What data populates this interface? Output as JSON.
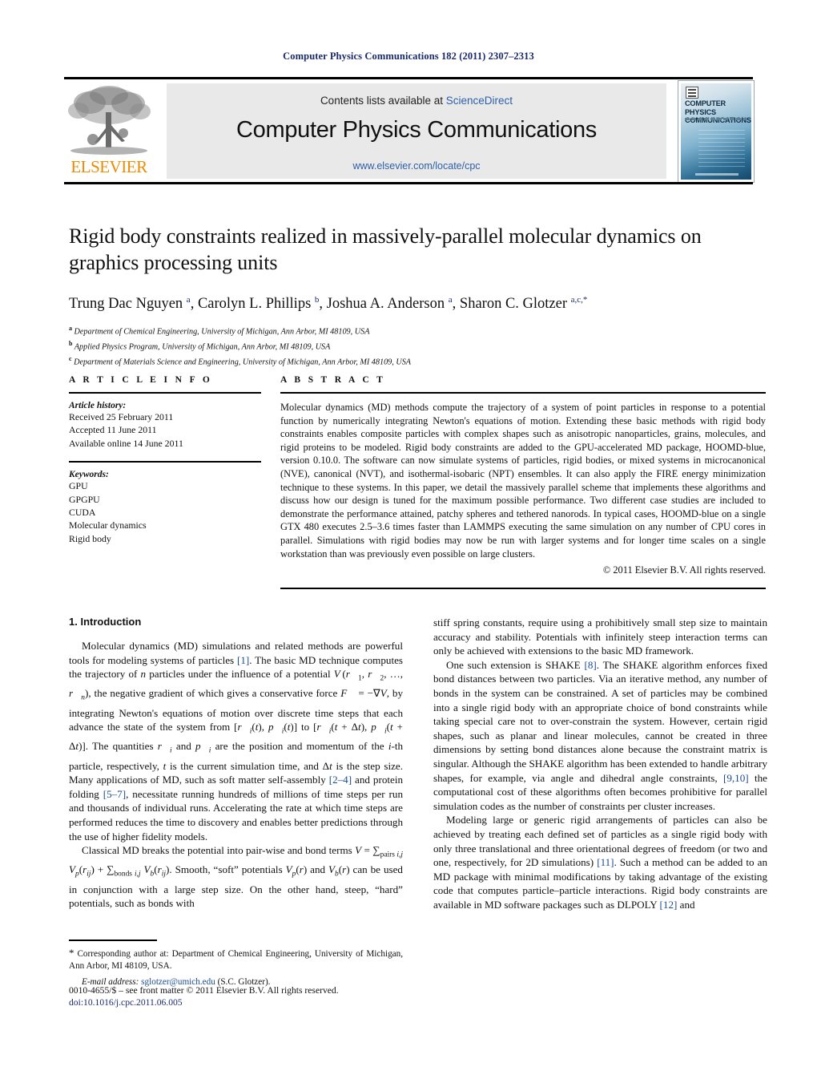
{
  "running_head": "Computer Physics Communications 182 (2011) 2307–2313",
  "masthead": {
    "publisher_name": "ELSEVIER",
    "publisher_logo_alt": "elsevier-tree-logo",
    "contents_prefix": "Contents lists available at ",
    "contents_link": "ScienceDirect",
    "journal_title": "Computer Physics Communications",
    "journal_url": "www.elsevier.com/locate/cpc",
    "cover_title_line1": "COMPUTER PHYSICS",
    "cover_title_line2": "COMMUNICATIONS"
  },
  "title": "Rigid body constraints realized in massively-parallel molecular dynamics on graphics processing units",
  "authors_html": "Trung Dac Nguyen <sup>a</sup>, Carolyn L. Phillips <sup>b</sup>, Joshua A. Anderson <sup>a</sup>, Sharon C. Glotzer <sup>a,c,</sup><sup>*</sup>",
  "affiliations": [
    {
      "marker": "a",
      "text": "Department of Chemical Engineering, University of Michigan, Ann Arbor, MI 48109, USA"
    },
    {
      "marker": "b",
      "text": "Applied Physics Program, University of Michigan, Ann Arbor, MI 48109, USA"
    },
    {
      "marker": "c",
      "text": "Department of Materials Science and Engineering, University of Michigan, Ann Arbor, MI 48109, USA"
    }
  ],
  "article_info": {
    "heading": "A R T I C L E    I N F O",
    "history_label": "Article history:",
    "history": [
      "Received 25 February 2011",
      "Accepted 11 June 2011",
      "Available online 14 June 2011"
    ],
    "keywords_label": "Keywords:",
    "keywords": [
      "GPU",
      "GPGPU",
      "CUDA",
      "Molecular dynamics",
      "Rigid body"
    ]
  },
  "abstract": {
    "heading": "A B S T R A C T",
    "text": "Molecular dynamics (MD) methods compute the trajectory of a system of point particles in response to a potential function by numerically integrating Newton's equations of motion. Extending these basic methods with rigid body constraints enables composite particles with complex shapes such as anisotropic nanoparticles, grains, molecules, and rigid proteins to be modeled. Rigid body constraints are added to the GPU-accelerated MD package, HOOMD-blue, version 0.10.0. The software can now simulate systems of particles, rigid bodies, or mixed systems in microcanonical (NVE), canonical (NVT), and isothermal-isobaric (NPT) ensembles. It can also apply the FIRE energy minimization technique to these systems. In this paper, we detail the massively parallel scheme that implements these algorithms and discuss how our design is tuned for the maximum possible performance. Two different case studies are included to demonstrate the performance attained, patchy spheres and tethered nanorods. In typical cases, HOOMD-blue on a single GTX 480 executes 2.5–3.6 times faster than LAMMPS executing the same simulation on any number of CPU cores in parallel. Simulations with rigid bodies may now be run with larger systems and for longer time scales on a single workstation than was previously even possible on large clusters.",
    "copyright": "© 2011 Elsevier B.V. All rights reserved."
  },
  "body": {
    "section_title": "1. Introduction",
    "left_paragraphs": [
      "Molecular dynamics (MD) simulations and related methods are powerful tools for modeling systems of particles [1]. The basic MD technique computes the trajectory of n particles under the influence of a potential V(r1, r2, ..., rn), the negative gradient of which gives a conservative force F = −∇V, by integrating Newton's equations of motion over discrete time steps that each advance the state of the system from [ri(t), pi(t)] to [ri(t + Δt), pi(t + Δt)]. The quantities ri and pi are the position and momentum of the i-th particle, respectively, t is the current simulation time, and Δt is the step size. Many applications of MD, such as soft matter self-assembly [2–4] and protein folding [5–7], necessitate running hundreds of millions of time steps per run and thousands of individual runs. Accelerating the rate at which time steps are performed reduces the time to discovery and enables better predictions through the use of higher fidelity models.",
      "Classical MD breaks the potential into pair-wise and bond terms V = Σpairs i,j Vp(rij) + Σbonds i,j Vb(rij). Smooth, \"soft\" potentials Vp(r) and Vb(r) can be used in conjunction with a large step size. On the other hand, steep, \"hard\" potentials, such as bonds with"
    ],
    "right_paragraphs": [
      "stiff spring constants, require using a prohibitively small step size to maintain accuracy and stability. Potentials with infinitely steep interaction terms can only be achieved with extensions to the basic MD framework.",
      "One such extension is SHAKE [8]. The SHAKE algorithm enforces fixed bond distances between two particles. Via an iterative method, any number of bonds in the system can be constrained. A set of particles may be combined into a single rigid body with an appropriate choice of bond constraints while taking special care not to over-constrain the system. However, certain rigid shapes, such as planar and linear molecules, cannot be created in three dimensions by setting bond distances alone because the constraint matrix is singular. Although the SHAKE algorithm has been extended to handle arbitrary shapes, for example, via angle and dihedral angle constraints, [9,10] the computational cost of these algorithms often becomes prohibitive for parallel simulation codes as the number of constraints per cluster increases.",
      "Modeling large or generic rigid arrangements of particles can also be achieved by treating each defined set of particles as a single rigid body with only three translational and three orientational degrees of freedom (or two and one, respectively, for 2D simulations) [11]. Such a method can be added to an MD package with minimal modifications by taking advantage of the existing code that computes particle–particle interactions. Rigid body constraints are available in MD software packages such as DLPOLY [12] and"
    ]
  },
  "footnote": {
    "marker": "*",
    "text": "Corresponding author at: Department of Chemical Engineering, University of Michigan, Ann Arbor, MI 48109, USA.",
    "email_label": "E-mail address:",
    "email": "sglotzer@umich.edu",
    "email_owner": "(S.C. Glotzer)."
  },
  "imprint": {
    "issn_line": "0010-4655/$ – see front matter  © 2011 Elsevier B.V. All rights reserved.",
    "doi": "doi:10.1016/j.cpc.2011.06.005"
  },
  "colors": {
    "link_blue": "#2d5fa8",
    "ref_blue": "#1b4b8f",
    "header_navy": "#1b2a6b",
    "elsevier_orange": "#ED8B00",
    "band_gray": "#e9e9e9"
  }
}
